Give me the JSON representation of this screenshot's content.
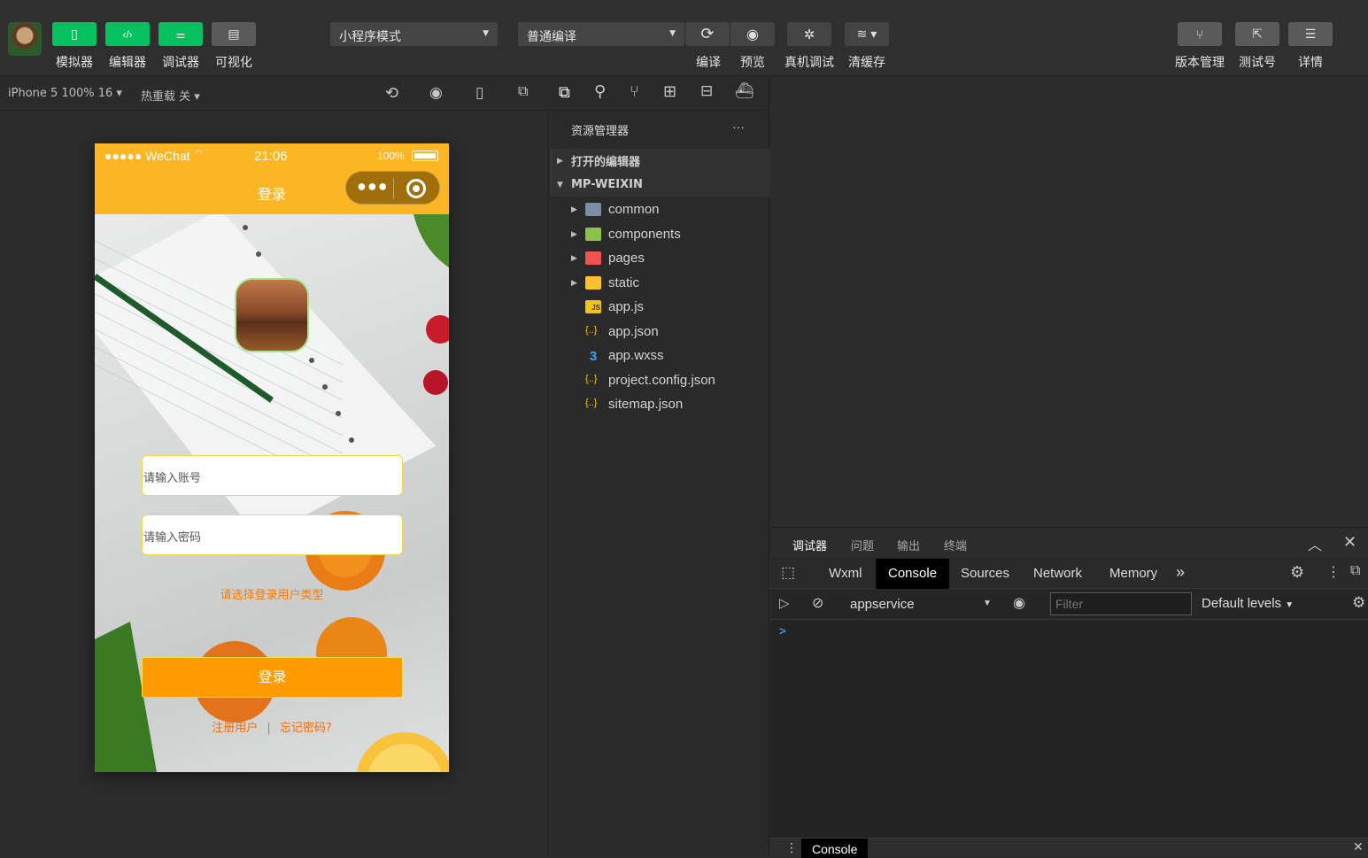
{
  "toolbar": {
    "left_buttons": [
      {
        "label": "模拟器",
        "icon": "phone-icon"
      },
      {
        "label": "编辑器",
        "icon": "code-icon"
      },
      {
        "label": "调试器",
        "icon": "sliders-icon"
      },
      {
        "label": "可视化",
        "icon": "layout-icon"
      }
    ],
    "mode_select": "小程序模式",
    "compile_select": "普通编译",
    "center_buttons": [
      {
        "label": "编译",
        "icon": "refresh-icon"
      },
      {
        "label": "预览",
        "icon": "eye-icon"
      },
      {
        "label": "真机调试",
        "icon": "bug-icon"
      },
      {
        "label": "清缓存",
        "icon": "layers-icon"
      }
    ],
    "right_buttons": [
      {
        "label": "版本管理",
        "icon": "branch-icon"
      },
      {
        "label": "测试号",
        "icon": "external-link-icon"
      },
      {
        "label": "详情",
        "icon": "menu-icon"
      }
    ]
  },
  "simulator": {
    "device": "iPhone 5 100% 16",
    "hot_reload": "热重载 关",
    "status": {
      "carrier": "●●●●● WeChat",
      "time": "21:06",
      "battery": "100%"
    },
    "nav_title": "登录",
    "account_placeholder": "请输入账号",
    "password_placeholder": "请输入密码",
    "user_type_hint": "请选择登录用户类型",
    "login_button": "登录",
    "register_link": "注册用户",
    "separator": "|",
    "forgot_link": "忘记密码?"
  },
  "explorer": {
    "title": "资源管理器",
    "more": "···",
    "open_editors": "打开的编辑器",
    "project": "MP-WEIXIN",
    "items": [
      {
        "name": "common",
        "type": "folder",
        "color": "#7a8fa6"
      },
      {
        "name": "components",
        "type": "folder",
        "color": "#8bc34a"
      },
      {
        "name": "pages",
        "type": "folder",
        "color": "#ef5350"
      },
      {
        "name": "static",
        "type": "folder",
        "color": "#fbc02d"
      },
      {
        "name": "app.js",
        "type": "file",
        "icon": "JS",
        "color": "#f0c419"
      },
      {
        "name": "app.json",
        "type": "file",
        "icon": "{..}",
        "color": "#f0c419"
      },
      {
        "name": "app.wxss",
        "type": "file",
        "icon": "3",
        "color": "#42a5f5"
      },
      {
        "name": "project.config.json",
        "type": "file",
        "icon": "{..}",
        "color": "#f0c419"
      },
      {
        "name": "sitemap.json",
        "type": "file",
        "icon": "{..}",
        "color": "#f0c419"
      }
    ]
  },
  "debugger": {
    "panel_tabs": [
      "调试器",
      "问题",
      "输出",
      "终端"
    ],
    "dev_tabs": [
      "Wxml",
      "Console",
      "Sources",
      "Network",
      "Memory"
    ],
    "active_dev_tab": "Console",
    "more_tabs": "»",
    "context_select": "appservice",
    "filter_placeholder": "Filter",
    "levels": "Default levels",
    "prompt": ">",
    "drawer_tab": "Console"
  },
  "colors": {
    "accent_green": "#07c160",
    "nav_yellow": "#fdb623",
    "login_orange": "#ff9a00"
  }
}
